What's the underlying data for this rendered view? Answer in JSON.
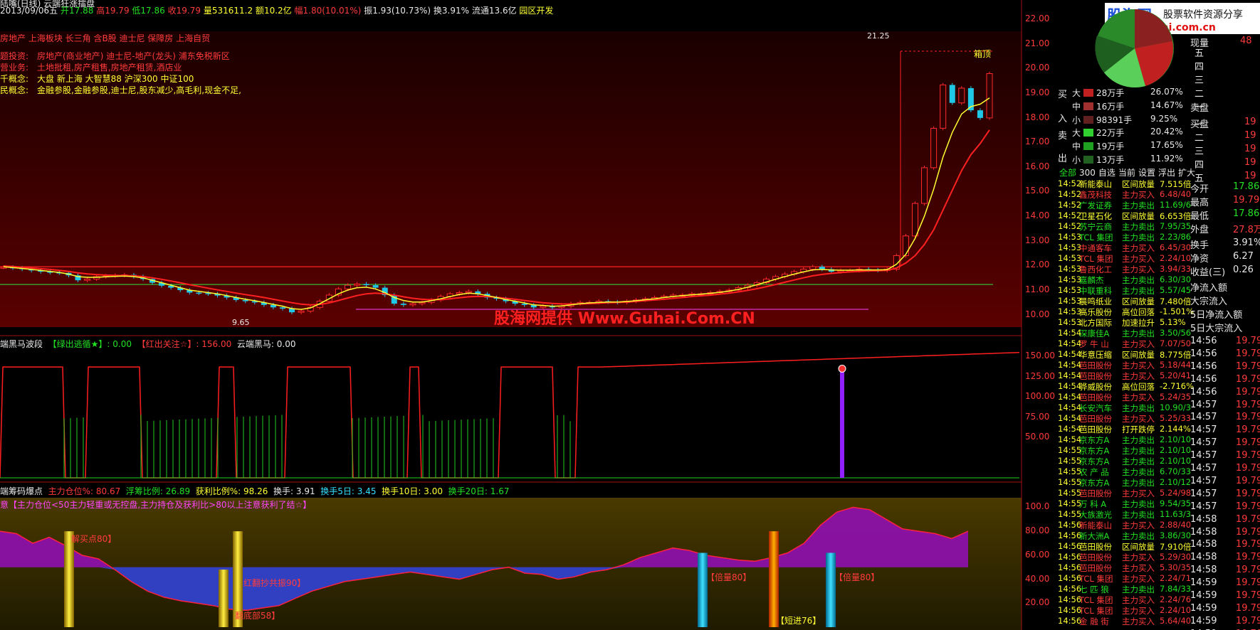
{
  "header": {
    "stock_date": "2013/09/06五",
    "open_lbl": "开",
    "open": "17.88",
    "high_lbl": "高",
    "high": "19.79",
    "low_lbl": "低",
    "low": "17.86",
    "close_lbl": "收",
    "close": "19.79",
    "vol_lbl": "量",
    "vol": "531611.2",
    "amt_lbl": "额",
    "amt": "10.2亿",
    "chg_lbl": "幅",
    "chg": "1.80(10.01%)",
    "amp_lbl": "振",
    "amp": "1.93(10.73%)",
    "turn_lbl": "换",
    "turn": "3.91%",
    "float_lbl": "流通",
    "float": "13.6亿",
    "sector": "园区开发",
    "top_line": "陆嘴(日线)  云端狂涨擂盘"
  },
  "info": {
    "concepts_top": "房地产 上海板块 长三角 含B股 迪士尼 保障房 上海自贸",
    "rows": [
      {
        "label": "题投资:",
        "text": "房地产(商业地产) 迪士尼-地产(龙头) 浦东免税新区"
      },
      {
        "label": "营业务:",
        "text": "土地批租,房产租售,房地产租赁,酒店业"
      },
      {
        "label": "千概念:",
        "text": "大盘 新上海 大智慧88 沪深300 中证100"
      },
      {
        "label": "民概念:",
        "text": "金融参股,金融参股,迪士尼,股东减少,高毛利,现金不足,"
      }
    ]
  },
  "main_axis": {
    "ticks": [
      "22.00",
      "21.00",
      "20.00",
      "19.00",
      "18.00",
      "17.00",
      "16.00",
      "15.00",
      "14.00",
      "13.00",
      "12.00",
      "11.00",
      "10.00"
    ]
  },
  "annotations": {
    "high": "21.25",
    "low": "9.65",
    "box_top": "箱顶",
    "watermark1": "股海网提供",
    "watermark2": "Www.Guhai.Com.CN"
  },
  "ind1": {
    "title": "端黑马波段",
    "l1": "【绿出逃循★】: 0.00",
    "l2": "【红出关注☆】: 156.00",
    "l3": "云端黑马: 0.00",
    "ticks": [
      "150.00",
      "125.00",
      "100.00",
      "75.00",
      "50.00"
    ]
  },
  "ind2": {
    "title": "端筹码爆点",
    "a": "主力仓位%: 80.67",
    "b": "浮筹比例: 26.89",
    "c": "获利比例%: 98.26",
    "d": "换手: 3.91",
    "e": "换手5日: 3.45",
    "f": "换手10日: 3.00",
    "g": "换手20日: 1.67",
    "note": "意【主力仓位<50主力轻重或无控盘,主力持仓及获利比>80以上注意获利了结☆】",
    "lab1": "【倍量80】",
    "lab2": "【倍量80】",
    "lab3": "【短进76】",
    "lab4": "红翻抄共振90】",
    "lab5": "翻底部58】",
    "lab6": "解买点80】",
    "ticks": [
      "100.0",
      "80.00",
      "60.00",
      "40.00",
      "20.00"
    ]
  },
  "panel": {
    "logo": "股海网",
    "logo_sub": "股票软件资源分享",
    "logo_url": "Www.Guhai.com.cn",
    "xianliang": "现量",
    "xl_val": "48",
    "buy": [
      {
        "side": "大",
        "v": "28万手",
        "p": "26.07%"
      },
      {
        "side": "中",
        "v": "16万手",
        "p": "14.67%"
      },
      {
        "side": "小",
        "v": "98391手",
        "p": "9.25%"
      }
    ],
    "sell": [
      {
        "side": "大",
        "v": "22万手",
        "p": "20.42%"
      },
      {
        "side": "中",
        "v": "19万手",
        "p": "17.65%"
      },
      {
        "side": "小",
        "v": "13万手",
        "p": "11.92%"
      }
    ],
    "buy_lbl": "买入",
    "sell_lbl": "卖出",
    "tabs": [
      "全部",
      "300",
      "自选",
      "当前",
      "设置",
      "浮出",
      "扩大"
    ],
    "book_right": [
      "五",
      "四",
      "三",
      "二",
      "一"
    ],
    "sell_pan": "卖盘",
    "buy_pan": "买盘",
    "stats": [
      {
        "k": "今开",
        "v": "17.86"
      },
      {
        "k": "最高",
        "v": "19.79"
      },
      {
        "k": "最低",
        "v": "17.86"
      },
      {
        "k": "外盘",
        "v": "27.8万"
      },
      {
        "k": "换手",
        "v": "3.91%"
      },
      {
        "k": "净资",
        "v": "6.27"
      },
      {
        "k": "收益(三)",
        "v": "0.26"
      }
    ],
    "flows": [
      "净流入额",
      "大宗流入",
      "5日净流入额",
      "5日大宗流入"
    ],
    "radar": [
      {
        "t": "14:52",
        "n": "新能泰山",
        "s": "区间放量",
        "v": "7.515倍"
      },
      {
        "t": "14:52",
        "n": "鑫茂科技",
        "s": "主力买入",
        "v": "6.48/40"
      },
      {
        "t": "14:52",
        "n": "广发证券",
        "s": "主力卖出",
        "v": "11.69/6"
      },
      {
        "t": "14:52",
        "n": "卫星石化",
        "s": "区间放量",
        "v": "6.653倍"
      },
      {
        "t": "14:52",
        "n": "苏宁云商",
        "s": "主力卖出",
        "v": "7.95/35"
      },
      {
        "t": "14:53",
        "n": "TCL 集团",
        "s": "主力卖出",
        "v": "2.23/86"
      },
      {
        "t": "14:53",
        "n": "中通客车",
        "s": "主力买入",
        "v": "6.45/30"
      },
      {
        "t": "14:53",
        "n": "TCL 集团",
        "s": "主力买入",
        "v": "2.24/10"
      },
      {
        "t": "14:53",
        "n": "鲁西化工",
        "s": "主力买入",
        "v": "3.94/33"
      },
      {
        "t": "14:53",
        "n": "嘉麟杰",
        "s": "主力卖出",
        "v": "6.30/30"
      },
      {
        "t": "14:53",
        "n": "中联重科",
        "s": "主力卖出",
        "v": "5.57/45"
      },
      {
        "t": "14:53",
        "n": "晨鸣纸业",
        "s": "区间放量",
        "v": "7.480倍"
      },
      {
        "t": "14:53",
        "n": "高乐股份",
        "s": "高位回落",
        "v": "-1.501%"
      },
      {
        "t": "14:53",
        "n": "北方国际",
        "s": "加速拉升",
        "v": "5.13%"
      },
      {
        "t": "14:54",
        "n": "深康佳A",
        "s": "主力卖出",
        "v": "3.50/56"
      },
      {
        "t": "14:54",
        "n": "罗 牛 山",
        "s": "主力买入",
        "v": "7.07/50"
      },
      {
        "t": "14:54",
        "n": "华意压缩",
        "s": "区间放量",
        "v": "8.775倍"
      },
      {
        "t": "14:54",
        "n": "芭田股份",
        "s": "主力买入",
        "v": "5.18/44"
      },
      {
        "t": "14:54",
        "n": "芭田股份",
        "s": "主力买入",
        "v": "5.20/41"
      },
      {
        "t": "14:54",
        "n": "骅威股份",
        "s": "高位回落",
        "v": "-2.716%"
      },
      {
        "t": "14:54",
        "n": "芭田股份",
        "s": "主力买入",
        "v": "5.24/35"
      },
      {
        "t": "14:54",
        "n": "长安汽车",
        "s": "主力卖出",
        "v": "10.90/3"
      },
      {
        "t": "14:54",
        "n": "芭田股份",
        "s": "主力买入",
        "v": "5.25/33"
      },
      {
        "t": "14:54",
        "n": "芭田股份",
        "s": "打开跌停",
        "v": "2.144%"
      },
      {
        "t": "14:54",
        "n": "京东方A",
        "s": "主力卖出",
        "v": "2.10/10"
      },
      {
        "t": "14:55",
        "n": "京东方A",
        "s": "主力卖出",
        "v": "2.10/10"
      },
      {
        "t": "14:55",
        "n": "京东方A",
        "s": "主力卖出",
        "v": "2.10/10"
      },
      {
        "t": "14:55",
        "n": "农 产 品",
        "s": "主力卖出",
        "v": "6.70/33"
      },
      {
        "t": "14:55",
        "n": "京东方A",
        "s": "主力卖出",
        "v": "2.10/12"
      },
      {
        "t": "14:55",
        "n": "芭田股份",
        "s": "主力买入",
        "v": "5.24/98"
      },
      {
        "t": "14:55",
        "n": "万 科 A",
        "s": "主力卖出",
        "v": "9.54/35"
      },
      {
        "t": "14:55",
        "n": "大族激光",
        "s": "主力卖出",
        "v": "11.63/3"
      },
      {
        "t": "14:56",
        "n": "新能泰山",
        "s": "主力买入",
        "v": "2.88/40"
      },
      {
        "t": "14:56",
        "n": "新大洲A",
        "s": "主力卖出",
        "v": "3.86/30"
      },
      {
        "t": "14:56",
        "n": "芭田股份",
        "s": "区间放量",
        "v": "7.910倍"
      },
      {
        "t": "14:56",
        "n": "芭田股份",
        "s": "主力买入",
        "v": "5.29/30"
      },
      {
        "t": "14:56",
        "n": "芭田股份",
        "s": "主力买入",
        "v": "5.30/35"
      },
      {
        "t": "14:56",
        "n": "TCL 集团",
        "s": "主力买入",
        "v": "2.24/71"
      },
      {
        "t": "14:56",
        "n": "七 匹 狼",
        "s": "主力卖出",
        "v": "7.84/33"
      },
      {
        "t": "14:56",
        "n": "TCL 集团",
        "s": "主力买入",
        "v": "2.24/76"
      },
      {
        "t": "14:56",
        "n": "TCL 集团",
        "s": "主力买入",
        "v": "2.24/10"
      },
      {
        "t": "14:56",
        "n": "金 融 街",
        "s": "主力买入",
        "v": "5.64/40"
      }
    ],
    "ticks": [
      {
        "t": "14:56",
        "p": "19.79"
      },
      {
        "t": "14:56",
        "p": "19.79"
      },
      {
        "t": "14:56",
        "p": "19.79"
      },
      {
        "t": "14:56",
        "p": "19.79"
      },
      {
        "t": "14:56",
        "p": "19.79"
      },
      {
        "t": "14:57",
        "p": "19.79"
      },
      {
        "t": "14:57",
        "p": "19.79"
      },
      {
        "t": "14:57",
        "p": "19.79"
      },
      {
        "t": "14:57",
        "p": "19.79"
      },
      {
        "t": "14:57",
        "p": "19.79"
      },
      {
        "t": "14:57",
        "p": "19.79"
      },
      {
        "t": "14:57",
        "p": "19.79"
      },
      {
        "t": "14:57",
        "p": "19.79"
      },
      {
        "t": "14:57",
        "p": "19.79"
      },
      {
        "t": "14:58",
        "p": "19.79"
      },
      {
        "t": "14:58",
        "p": "19.79"
      },
      {
        "t": "14:58",
        "p": "19.79"
      },
      {
        "t": "14:58",
        "p": "19.79"
      },
      {
        "t": "14:58",
        "p": "19.79"
      },
      {
        "t": "14:59",
        "p": "19.79"
      },
      {
        "t": "14:59",
        "p": "19.79"
      },
      {
        "t": "14:59",
        "p": "19.79"
      },
      {
        "t": "14:59",
        "p": "19.79"
      },
      {
        "t": "14:59",
        "p": "19.79"
      }
    ]
  },
  "chart_data": {
    "type": "line",
    "ylim": [
      9.5,
      22.2
    ],
    "close": [
      11.93,
      11.9,
      11.85,
      11.8,
      11.75,
      11.72,
      11.7,
      11.6,
      11.4,
      11.45,
      11.55,
      11.58,
      11.6,
      11.62,
      11.55,
      11.45,
      11.3,
      11.18,
      11.1,
      11.0,
      10.9,
      10.88,
      10.85,
      10.78,
      10.7,
      10.6,
      10.55,
      10.5,
      10.4,
      10.3,
      10.25,
      10.1,
      10.15,
      10.3,
      10.55,
      10.8,
      11.05,
      11.2,
      11.25,
      11.2,
      11.1,
      10.8,
      10.45,
      10.4,
      10.45,
      10.5,
      10.6,
      10.75,
      10.85,
      10.9,
      10.95,
      10.85,
      10.7,
      10.65,
      10.55,
      10.45,
      10.4,
      10.3,
      10.35,
      10.3,
      10.35,
      10.45,
      10.5,
      10.5,
      10.55,
      10.52,
      10.5,
      10.55,
      10.6,
      10.65,
      10.7,
      10.75,
      10.8,
      10.8,
      10.85,
      10.85,
      10.9,
      10.95,
      11.0,
      11.1,
      11.2,
      11.3,
      11.45,
      11.55,
      11.65,
      11.75,
      11.85,
      11.95,
      11.85,
      11.75,
      11.8,
      11.8,
      11.85,
      11.82,
      11.8,
      11.85,
      12.4,
      13.2,
      14.52,
      15.97,
      17.57,
      19.33,
      18.6,
      19.2,
      18.3,
      17.99,
      19.79
    ],
    "ma1": [
      11.95,
      11.92,
      11.88,
      11.84,
      11.8,
      11.76,
      11.72,
      11.65,
      11.55,
      11.52,
      11.52,
      11.54,
      11.56,
      11.57,
      11.55,
      11.5,
      11.4,
      11.3,
      11.2,
      11.1,
      11.0,
      10.95,
      10.9,
      10.85,
      10.78,
      10.7,
      10.63,
      10.57,
      10.5,
      10.42,
      10.35,
      10.25,
      10.22,
      10.28,
      10.45,
      10.65,
      10.85,
      11.0,
      11.1,
      11.12,
      11.05,
      10.9,
      10.7,
      10.58,
      10.52,
      10.52,
      10.57,
      10.65,
      10.74,
      10.82,
      10.88,
      10.85,
      10.78,
      10.7,
      10.62,
      10.55,
      10.48,
      10.4,
      10.38,
      10.35,
      10.36,
      10.4,
      10.45,
      10.48,
      10.5,
      10.52,
      10.52,
      10.54,
      10.57,
      10.61,
      10.65,
      10.7,
      10.74,
      10.78,
      10.81,
      10.84,
      10.87,
      10.91,
      10.96,
      11.03,
      11.12,
      11.22,
      11.33,
      11.44,
      11.55,
      11.65,
      11.74,
      11.82,
      11.84,
      11.82,
      11.81,
      11.81,
      11.82,
      11.82,
      11.82,
      11.83,
      12.05,
      12.45,
      13.1,
      14.0,
      15.1,
      16.4,
      17.4,
      18.15,
      18.45,
      18.55,
      18.8
    ],
    "ma2": [
      11.98,
      11.96,
      11.93,
      11.9,
      11.87,
      11.84,
      11.8,
      11.76,
      11.7,
      11.66,
      11.63,
      11.61,
      11.6,
      11.59,
      11.58,
      11.55,
      11.5,
      11.44,
      11.37,
      11.3,
      11.22,
      11.15,
      11.08,
      11.01,
      10.95,
      10.88,
      10.82,
      10.76,
      10.7,
      10.63,
      10.56,
      10.49,
      10.43,
      10.4,
      10.42,
      10.48,
      10.58,
      10.68,
      10.78,
      10.85,
      10.88,
      10.85,
      10.8,
      10.73,
      10.67,
      10.63,
      10.61,
      10.62,
      10.65,
      10.69,
      10.73,
      10.75,
      10.74,
      10.71,
      10.67,
      10.63,
      10.58,
      10.53,
      10.49,
      10.46,
      10.44,
      10.43,
      10.44,
      10.45,
      10.47,
      10.49,
      10.5,
      10.52,
      10.54,
      10.57,
      10.6,
      10.63,
      10.67,
      10.7,
      10.74,
      10.77,
      10.8,
      10.84,
      10.88,
      10.93,
      10.99,
      11.06,
      11.14,
      11.23,
      11.32,
      11.41,
      11.5,
      11.58,
      11.64,
      11.68,
      11.71,
      11.74,
      11.76,
      11.78,
      11.79,
      11.8,
      11.9,
      12.1,
      12.4,
      12.85,
      13.45,
      14.25,
      15.05,
      15.85,
      16.5,
      16.95,
      17.5
    ]
  }
}
